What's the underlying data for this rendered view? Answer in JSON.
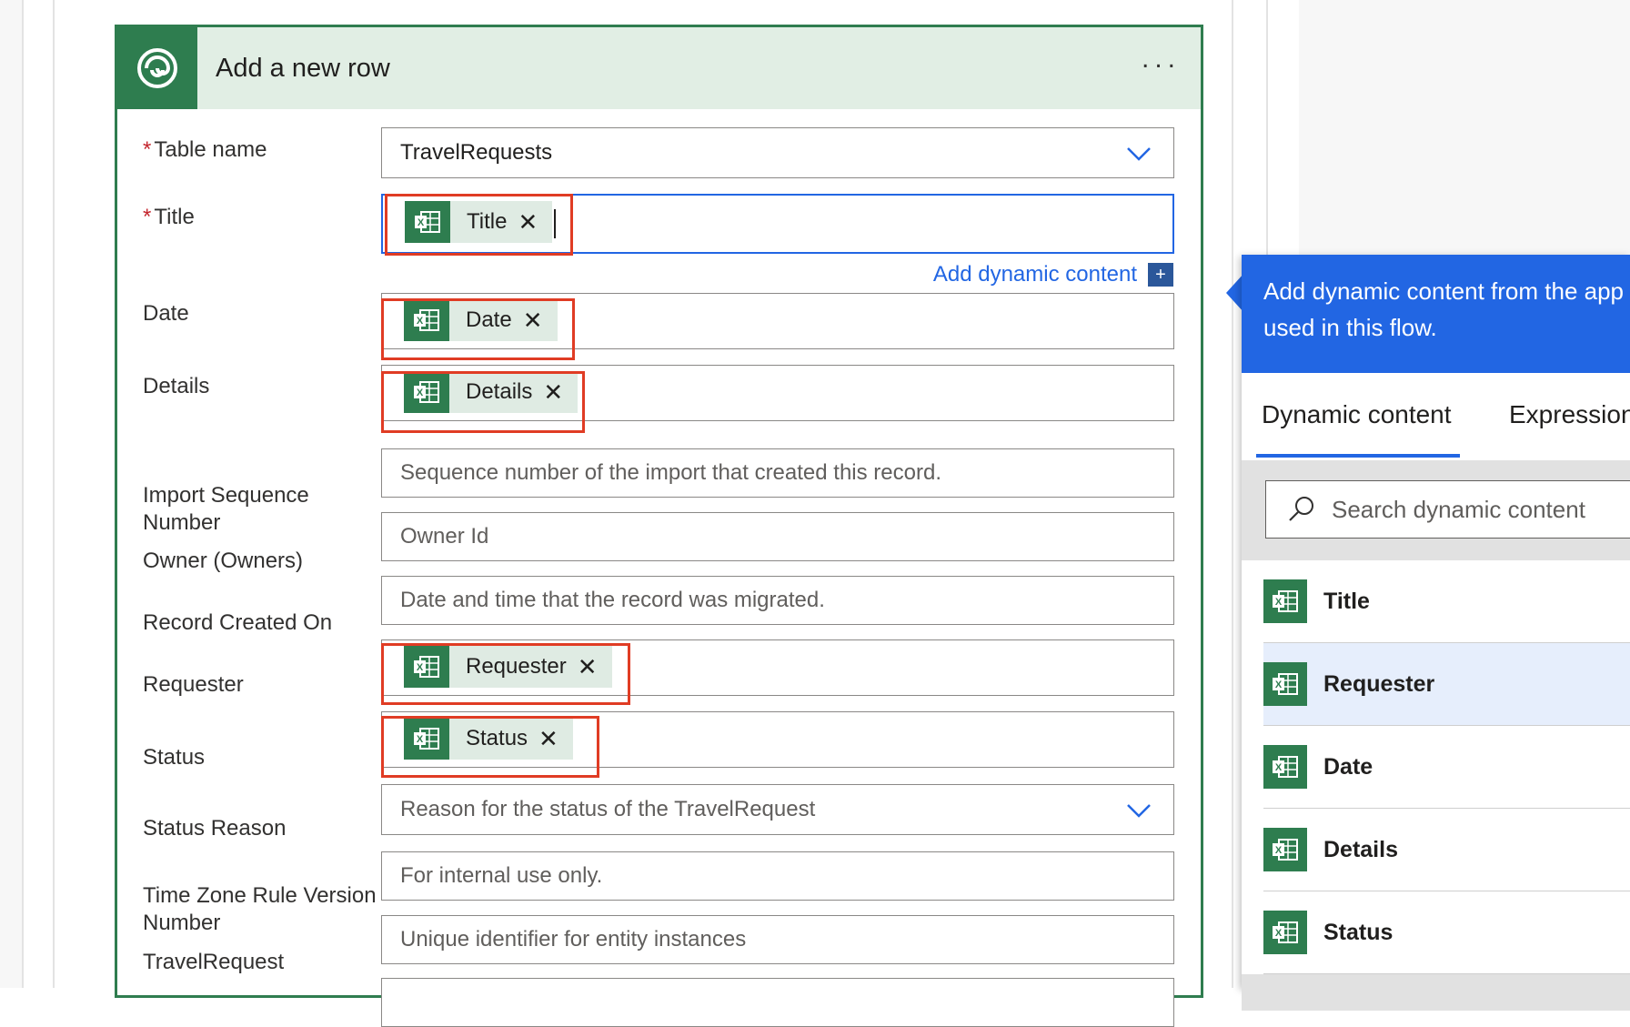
{
  "action": {
    "title": "Add a new row",
    "more": "..."
  },
  "fields": {
    "table_name": {
      "label": "Table name",
      "required": "*",
      "value": "TravelRequests"
    },
    "title": {
      "label": "Title",
      "required": "*",
      "token": "Title"
    },
    "add_dynamic_content": "Add dynamic content",
    "date": {
      "label": "Date",
      "token": "Date"
    },
    "details": {
      "label": "Details",
      "token": "Details"
    },
    "import_seq": {
      "label_line1": "Import Sequence",
      "label_line2": "Number",
      "placeholder": "Sequence number of the import that created this record."
    },
    "owner": {
      "label": "Owner (Owners)",
      "placeholder": "Owner Id"
    },
    "record_created": {
      "label": "Record Created On",
      "placeholder": "Date and time that the record was migrated."
    },
    "requester": {
      "label": "Requester",
      "token": "Requester"
    },
    "status": {
      "label": "Status",
      "token": "Status"
    },
    "status_reason": {
      "label": "Status Reason",
      "placeholder": "Reason for the status of the TravelRequest"
    },
    "tz_rule": {
      "label_line1": "Time Zone Rule Version",
      "label_line2": "Number",
      "placeholder": "For internal use only."
    },
    "travel_request": {
      "label": "TravelRequest",
      "placeholder": "Unique identifier for entity instances"
    }
  },
  "token_remove_glyph": "✕",
  "add_button_glyph": "+",
  "panel": {
    "header_line1": "Add dynamic content from the app",
    "header_line2": "used in this flow.",
    "tab_dynamic": "Dynamic content",
    "tab_expression": "Expression",
    "search_placeholder": "Search dynamic content",
    "items": [
      "Title",
      "Requester",
      "Date",
      "Details",
      "Status"
    ],
    "selected_item": "Requester"
  },
  "colors": {
    "accent": "#2266e3",
    "excel_green": "#2e7d4f",
    "highlight_red": "#e03c24",
    "card_header": "#e1eee4"
  },
  "icons": {
    "connector": "dataverse-logo-icon",
    "token": "excel-icon",
    "dropdown": "chevron-down-icon",
    "search": "search-icon"
  }
}
